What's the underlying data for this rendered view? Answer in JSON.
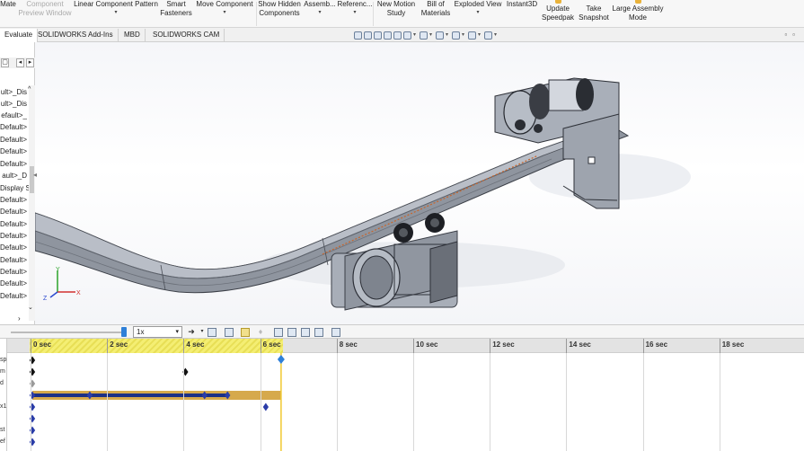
{
  "ribbon": {
    "items": [
      {
        "l1": "Mate",
        "l2": "",
        "dd": ""
      },
      {
        "l1": "Component",
        "l2": "Preview Window",
        "dd": ""
      },
      {
        "l1": "Linear Component Pattern",
        "l2": "",
        "dd": "▾"
      },
      {
        "l1": "Smart",
        "l2": "Fasteners",
        "dd": ""
      },
      {
        "l1": "Move Component",
        "l2": "",
        "dd": "▾"
      },
      {
        "l1": "Show Hidden",
        "l2": "Components",
        "dd": ""
      },
      {
        "l1": "Assemb...",
        "l2": "",
        "dd": "▾"
      },
      {
        "l1": "Referenc...",
        "l2": "",
        "dd": "▾"
      },
      {
        "l1": "New Motion",
        "l2": "Study",
        "dd": ""
      },
      {
        "l1": "Bill of",
        "l2": "Materials",
        "dd": ""
      },
      {
        "l1": "Exploded View",
        "l2": "",
        "dd": "▾"
      },
      {
        "l1": "Instant3D",
        "l2": "",
        "dd": ""
      },
      {
        "l1": "Update",
        "l2": "Speedpak",
        "dd": ""
      },
      {
        "l1": "Take",
        "l2": "Snapshot",
        "dd": ""
      },
      {
        "l1": "Large Assembly",
        "l2": "Mode",
        "dd": ""
      }
    ]
  },
  "tabs": [
    "Evaluate",
    "SOLIDWORKS Add-Ins",
    "MBD",
    "SOLIDWORKS CAM"
  ],
  "tree": {
    "items": [
      "ult>_Dis",
      "ult>_Dis",
      "efault>_",
      "Default>",
      "Default>",
      "Default>",
      "Default>",
      "ault>_D",
      "Display S",
      "Default>",
      "Default>",
      "Default>",
      "Default>",
      "Default>",
      "Default>",
      "Default>",
      "Default>",
      "Default>"
    ]
  },
  "motion": {
    "speed": "1x",
    "speed_options": [
      "1x"
    ]
  },
  "timeline": {
    "ticks": [
      "0 sec",
      "2 sec",
      "4 sec",
      "6 sec",
      "8 sec",
      "10 sec",
      "12 sec",
      "14 sec",
      "16 sec",
      "18 sec"
    ],
    "row_labels": [
      "sp",
      "m",
      "d",
      "",
      "x1",
      "",
      "st",
      "ef",
      ""
    ],
    "playhead_sec": 6.5,
    "keyframes": [
      {
        "row": 0,
        "secs": [
          0
        ]
      },
      {
        "row": 1,
        "secs": [
          0,
          4
        ]
      },
      {
        "row": 2,
        "secs": [
          0
        ]
      },
      {
        "row": 3,
        "secs": [
          0,
          1.5,
          4.5,
          5.1
        ],
        "bar_end": 5.1,
        "bar2_end": 6.5
      },
      {
        "row": 4,
        "secs": [
          0,
          6.1
        ]
      },
      {
        "row": 5,
        "secs": [
          0
        ]
      },
      {
        "row": 6,
        "secs": [
          0
        ]
      },
      {
        "row": 7,
        "secs": [
          0
        ]
      }
    ]
  },
  "colors": {
    "accent": "#2f80d8",
    "bar": "#1b2f86",
    "bar_gold": "#d6a94c",
    "timeline_highlight": "#f4ee73",
    "model_gray": "#9aa0ad"
  }
}
